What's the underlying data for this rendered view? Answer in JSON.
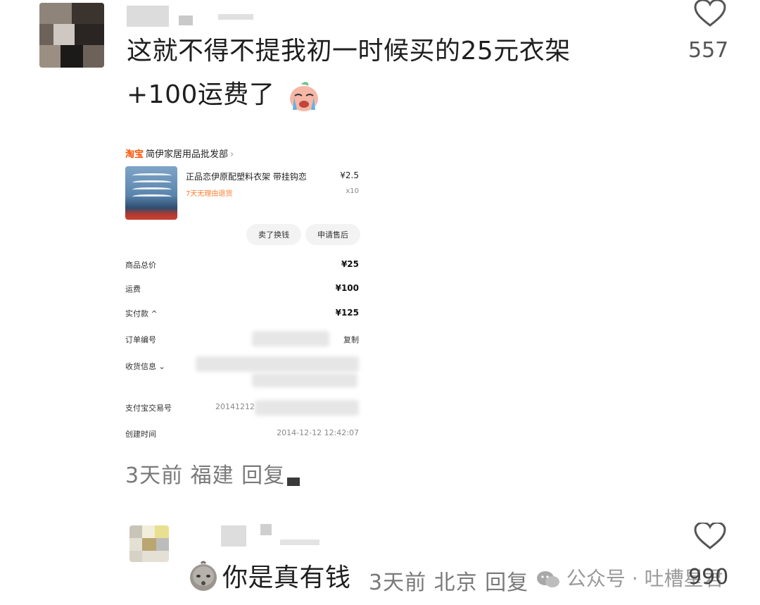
{
  "comment1": {
    "line1": "这就不得不提我初一时候买的25元衣架",
    "line2": "+100运费了",
    "likes": "557",
    "meta": "3天前 福建 回复",
    "emoji": "crying-face-emoji"
  },
  "order": {
    "shop_tag": "淘宝",
    "shop_name": "简伊家居用品批发部",
    "shop_arrow": "›",
    "product_title": "正品恋伊原配塑料衣架 带挂钩恋",
    "product_sub": "7天无理由退货",
    "product_price": "¥2.5",
    "product_qty": "x10",
    "btn_sell": "卖了换钱",
    "btn_after_sale": "申请售后",
    "rows": [
      {
        "label": "商品总价",
        "value": "¥25"
      },
      {
        "label": "运费",
        "value": "¥100"
      },
      {
        "label": "实付款 ^",
        "value": "¥125"
      },
      {
        "label": "订单编号",
        "value": "复制"
      },
      {
        "label": "收货信息 ⌄",
        "value": ""
      },
      {
        "label": "支付宝交易号",
        "mid": "20141212",
        "value": ""
      },
      {
        "label": "创建时间",
        "value": "2014-12-12 12:42:07"
      }
    ]
  },
  "comment2": {
    "text": "你是真有钱",
    "meta": "3天前 北京 回复",
    "likes": "990",
    "emoji": "tired-face-emoji"
  },
  "watermark": {
    "text": "公众号 · 吐槽星君",
    "icon": "wechat-icon"
  },
  "colors": {
    "text": "#1f1f1f",
    "meta": "#7a7a7a",
    "taobao_orange": "#ff5000"
  }
}
